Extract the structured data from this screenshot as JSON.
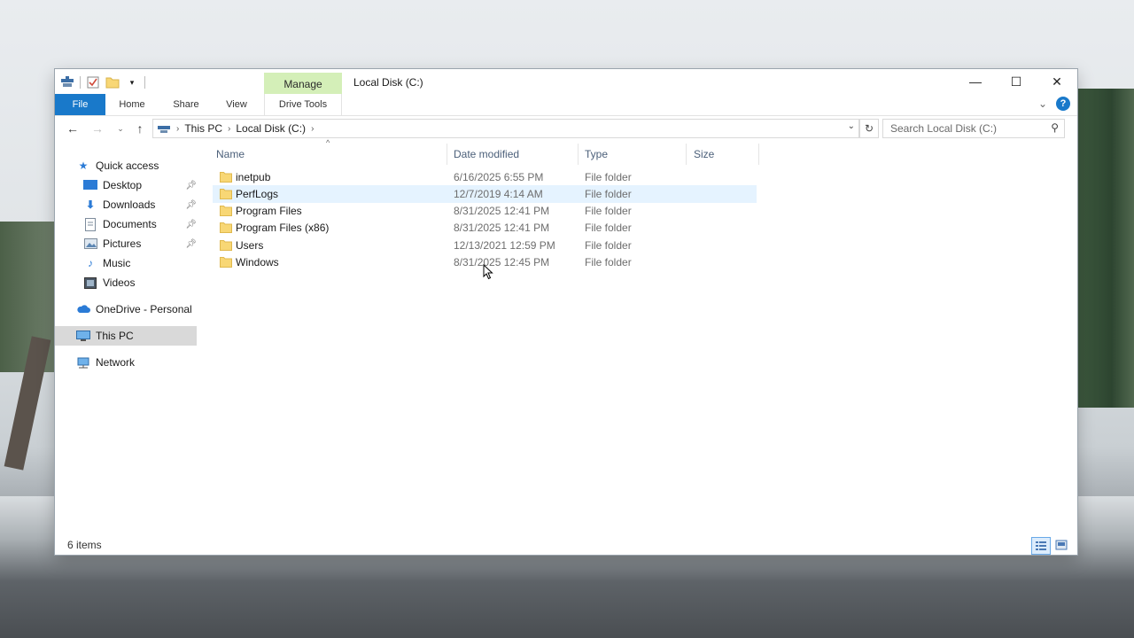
{
  "window": {
    "title": "Local Disk (C:)",
    "manage_tab": "Manage",
    "controls": {
      "minimize": "—",
      "maximize": "☐",
      "close": "✕"
    }
  },
  "ribbon": {
    "tabs": [
      "File",
      "Home",
      "Share",
      "View",
      "Drive Tools"
    ],
    "help": "?",
    "expand": "⌄"
  },
  "address": {
    "breadcrumb": [
      "This PC",
      "Local Disk (C:)"
    ],
    "search_placeholder": "Search Local Disk (C:)"
  },
  "navigation": {
    "items": [
      {
        "label": "Quick access",
        "icon": "star-icon"
      },
      {
        "label": "Desktop",
        "icon": "desktop-icon",
        "pinned": true
      },
      {
        "label": "Downloads",
        "icon": "download-icon",
        "pinned": true
      },
      {
        "label": "Documents",
        "icon": "documents-icon",
        "pinned": true
      },
      {
        "label": "Pictures",
        "icon": "pictures-icon",
        "pinned": true
      },
      {
        "label": "Music",
        "icon": "music-icon"
      },
      {
        "label": "Videos",
        "icon": "videos-icon"
      },
      {
        "label": "OneDrive - Personal",
        "icon": "cloud-icon"
      },
      {
        "label": "This PC",
        "icon": "computer-icon",
        "selected": true
      },
      {
        "label": "Network",
        "icon": "network-icon"
      }
    ]
  },
  "columns": [
    "Name",
    "Date modified",
    "Type",
    "Size"
  ],
  "files": [
    {
      "name": "inetpub",
      "date": "6/16/2025 6:55 PM",
      "type": "File folder"
    },
    {
      "name": "PerfLogs",
      "date": "12/7/2019 4:14 AM",
      "type": "File folder",
      "hover": true
    },
    {
      "name": "Program Files",
      "date": "8/31/2025 12:41 PM",
      "type": "File folder"
    },
    {
      "name": "Program Files (x86)",
      "date": "8/31/2025 12:41 PM",
      "type": "File folder"
    },
    {
      "name": "Users",
      "date": "12/13/2021 12:59 PM",
      "type": "File folder"
    },
    {
      "name": "Windows",
      "date": "8/31/2025 12:45 PM",
      "type": "File folder"
    }
  ],
  "status": {
    "item_count": "6 items"
  },
  "colors": {
    "accent": "#1979ca",
    "manage_bg": "#d4efb8",
    "folder": "#f8d775",
    "hover_row": "#e5f3ff"
  }
}
